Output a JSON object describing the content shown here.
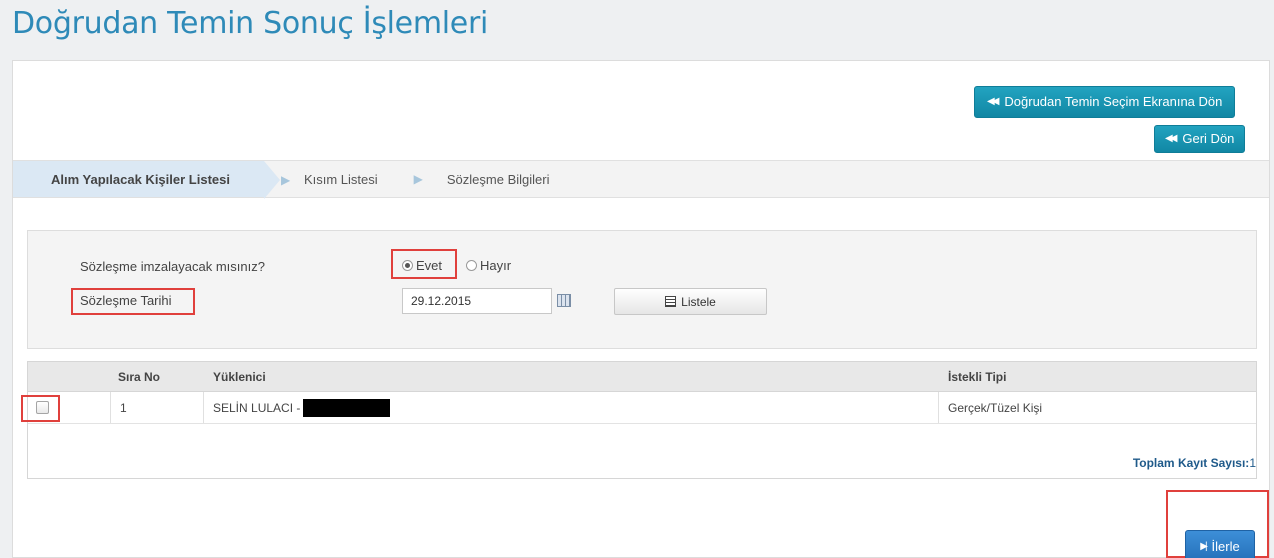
{
  "page": {
    "title": "Doğrudan Temin Sonuç İşlemleri"
  },
  "actions": {
    "back_to_selection_label": "Doğrudan Temin Seçim Ekranına Dön",
    "back_label": "Geri Dön",
    "next_label": "İlerle"
  },
  "steps": [
    {
      "label": "Alım Yapılacak Kişiler Listesi",
      "active": true
    },
    {
      "label": "Kısım Listesi",
      "active": false
    },
    {
      "label": "Sözleşme Bilgileri",
      "active": false
    }
  ],
  "form": {
    "contract_question": "Sözleşme imzalayacak mısınız?",
    "option_yes": "Evet",
    "option_no": "Hayır",
    "selected_option": "Evet",
    "contract_date_label": "Sözleşme Tarihi",
    "contract_date_value": "29.12.2015",
    "list_button_label": "Listele"
  },
  "grid": {
    "columns": [
      "Sıra No",
      "Yüklenici",
      "İstekli Tipi"
    ],
    "rows": [
      {
        "no": "1",
        "contractor": "SELİN LULACI -",
        "bidder_type": "Gerçek/Tüzel Kişi",
        "checked": false
      }
    ],
    "total_label": "Toplam Kayıt Sayısı:",
    "total_value": "1"
  },
  "colors": {
    "title": "#2e8ab8",
    "teal_button": "#1a96b3",
    "primary_button": "#2f7fc8",
    "highlight_border": "#e0403c",
    "active_step": "#dbe8f4"
  },
  "icons": {
    "back": "double-chevron-left-icon",
    "next": "step-forward-icon",
    "calendar": "calendar-icon",
    "list": "list-icon"
  }
}
